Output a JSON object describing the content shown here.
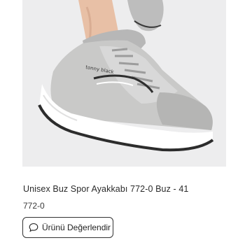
{
  "product": {
    "image_icon": "sneaker-photo",
    "brand_mark": "tonny black",
    "title": "Unisex Buz Spor Ayakkabı 772-0 Buz - 41",
    "code": "772-0"
  },
  "actions": {
    "review_label": "Ürünü Değerlendir",
    "review_icon": "speech-bubble-icon"
  },
  "colors": {
    "image_background": "#ededee",
    "text": "#2b2b2b",
    "button_border": "#333333"
  }
}
